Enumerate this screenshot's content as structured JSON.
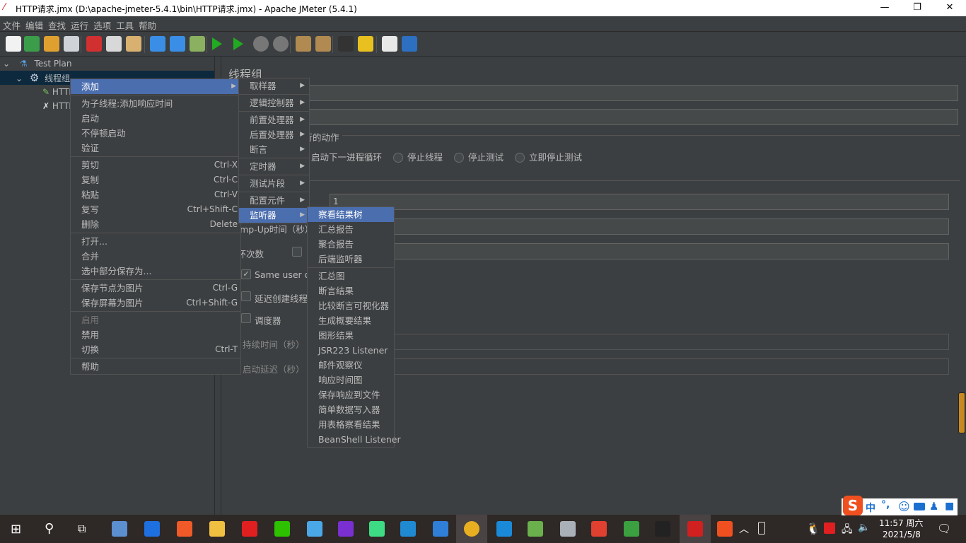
{
  "window": {
    "title": "HTTP请求.jmx (D:\\apache-jmeter-5.4.1\\bin\\HTTP请求.jmx) - Apache JMeter (5.4.1)",
    "minimize": "—",
    "maximize": "❐",
    "close": "✕"
  },
  "menubar": [
    "文件",
    "编辑",
    "查找",
    "运行",
    "选项",
    "工具",
    "帮助"
  ],
  "toolbar": [
    {
      "icon": "new-icon",
      "color": "#f2f2f2"
    },
    {
      "icon": "templates-icon",
      "color": "#3b9c4a"
    },
    {
      "icon": "open-icon",
      "color": "#e0a030"
    },
    {
      "icon": "save-icon",
      "color": "#cfd3d8"
    },
    {
      "icon": "cut-icon",
      "color": "#d03030"
    },
    {
      "icon": "copy-icon",
      "color": "#d8d8d8"
    },
    {
      "icon": "paste-icon",
      "color": "#d8b070"
    },
    {
      "icon": "expand-icon",
      "color": "#3a8ee6"
    },
    {
      "icon": "collapse-icon",
      "color": "#3a8ee6"
    },
    {
      "icon": "toggle-icon",
      "color": "#8ab060"
    },
    {
      "icon": "start-icon",
      "color": "#22aa22"
    },
    {
      "icon": "start-no-pause-icon",
      "color": "#22aa22"
    },
    {
      "icon": "stop-icon",
      "color": "#777777"
    },
    {
      "icon": "shutdown-icon",
      "color": "#777777"
    },
    {
      "icon": "clear-icon",
      "color": "#b08a50"
    },
    {
      "icon": "clear-all-icon",
      "color": "#b08a50"
    },
    {
      "icon": "search-icon",
      "color": "#333333"
    },
    {
      "icon": "reset-search-icon",
      "color": "#e8c020"
    },
    {
      "icon": "function-helper-icon",
      "color": "#e8e8e8"
    },
    {
      "icon": "help-icon",
      "color": "#2d6fc0"
    }
  ],
  "tree": {
    "test_plan": "Test Plan",
    "thread_group": "线程组",
    "child1": "HTTP",
    "child2": "HTTP"
  },
  "main": {
    "title": "线程组",
    "on_error_group": "在取样器错误后要执行的动作",
    "radio_options": [
      "启动下一进程循环",
      "停止线程",
      "停止测试",
      "立即停止测试"
    ],
    "threads_value": "1",
    "ramp_up_label": "Ramp-Up时间（秒）：",
    "loop_label": "循环次数",
    "same_user": "Same user on each iteration",
    "delay_create": "延迟创建线程直到需要",
    "scheduler": "调度器",
    "duration": "持续时间（秒）",
    "startup_delay": "启动延迟（秒）"
  },
  "context_menu": [
    {
      "label": "添加",
      "arrow": "▶",
      "hl": true
    },
    {
      "sep": true
    },
    {
      "label": "为子线程:添加响应时间"
    },
    {
      "label": "启动"
    },
    {
      "label": "不停顿启动"
    },
    {
      "label": "验证"
    },
    {
      "sep": true
    },
    {
      "label": "剪切",
      "sc": "Ctrl-X"
    },
    {
      "label": "复制",
      "sc": "Ctrl-C"
    },
    {
      "label": "粘贴",
      "sc": "Ctrl-V"
    },
    {
      "label": "复写",
      "sc": "Ctrl+Shift-C"
    },
    {
      "label": "删除",
      "sc": "Delete"
    },
    {
      "sep": true
    },
    {
      "label": "打开..."
    },
    {
      "label": "合并"
    },
    {
      "label": "选中部分保存为..."
    },
    {
      "sep": true
    },
    {
      "label": "保存节点为图片",
      "sc": "Ctrl-G"
    },
    {
      "label": "保存屏幕为图片",
      "sc": "Ctrl+Shift-G"
    },
    {
      "sep": true
    },
    {
      "label": "启用",
      "dis": true
    },
    {
      "label": "禁用"
    },
    {
      "label": "切换",
      "sc": "Ctrl-T"
    },
    {
      "sep": true
    },
    {
      "label": "帮助"
    }
  ],
  "add_submenu": [
    {
      "label": "取样器",
      "arrow": "▶"
    },
    {
      "sep": true
    },
    {
      "label": "逻辑控制器",
      "arrow": "▶"
    },
    {
      "sep": true
    },
    {
      "label": "前置处理器",
      "arrow": "▶"
    },
    {
      "label": "后置处理器",
      "arrow": "▶"
    },
    {
      "label": "断言",
      "arrow": "▶"
    },
    {
      "sep": true
    },
    {
      "label": "定时器",
      "arrow": "▶"
    },
    {
      "sep": true
    },
    {
      "label": "测试片段",
      "arrow": "▶"
    },
    {
      "sep": true
    },
    {
      "label": "配置元件",
      "arrow": "▶"
    },
    {
      "label": "监听器",
      "arrow": "▶",
      "hl": true
    }
  ],
  "listener_submenu": [
    {
      "label": "察看结果树",
      "hl": true
    },
    {
      "label": "汇总报告"
    },
    {
      "label": "聚合报告"
    },
    {
      "label": "后端监听器"
    },
    {
      "sep": true
    },
    {
      "label": "汇总图"
    },
    {
      "label": "断言结果"
    },
    {
      "label": "比较断言可视化器"
    },
    {
      "label": "生成概要结果"
    },
    {
      "label": "图形结果"
    },
    {
      "label": "JSR223 Listener"
    },
    {
      "label": "邮件观察仪"
    },
    {
      "label": "响应时间图"
    },
    {
      "label": "保存响应到文件"
    },
    {
      "label": "简单数据写入器"
    },
    {
      "label": "用表格察看结果"
    },
    {
      "label": "BeanShell Listener"
    }
  ],
  "ime": {
    "logo": "S",
    "mode": "中",
    "punct": "°,",
    "icons": [
      "emoji-icon",
      "keyboard-icon",
      "user-icon",
      "skin-icon"
    ]
  },
  "taskbar": {
    "apps": [
      {
        "icon": "file-manager-icon",
        "color": "#5b8fd0"
      },
      {
        "icon": "maps-icon",
        "color": "#1e6fe0"
      },
      {
        "icon": "browser-icon",
        "color": "#f05a28"
      },
      {
        "icon": "explorer-icon",
        "color": "#f0c040"
      },
      {
        "icon": "mail-icon",
        "color": "#e02020"
      },
      {
        "icon": "wechat-icon",
        "color": "#2dc100"
      },
      {
        "icon": "qq-icon",
        "color": "#4aa8e8"
      },
      {
        "icon": "intellij-icon",
        "color": "#7a2fd0"
      },
      {
        "icon": "android-studio-icon",
        "color": "#3ddc84"
      },
      {
        "icon": "vscode-icon",
        "color": "#1f8ad2"
      },
      {
        "icon": "app-icon",
        "color": "#2f7fd8"
      },
      {
        "icon": "chrome-icon",
        "color": "#e8b020"
      },
      {
        "icon": "edge-icon",
        "color": "#1a8ad8"
      },
      {
        "icon": "notepad-icon",
        "color": "#6ab04c"
      },
      {
        "icon": "calculator-icon",
        "color": "#aab0b8"
      },
      {
        "icon": "snail-icon",
        "color": "#e04030"
      },
      {
        "icon": "money-icon",
        "color": "#3aa040"
      },
      {
        "icon": "terminal-icon",
        "color": "#222222"
      },
      {
        "icon": "jmeter-icon",
        "color": "#d02020"
      },
      {
        "icon": "sogou-icon",
        "color": "#f05020"
      }
    ],
    "time": "11:57 周六",
    "date": "2021/5/8"
  }
}
